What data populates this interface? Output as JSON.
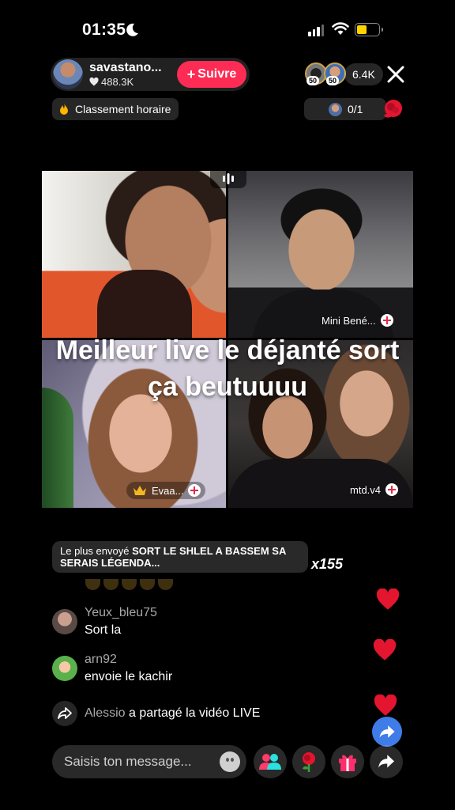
{
  "status_bar": {
    "time": "01:35",
    "battery_color": "#ffd400"
  },
  "host": {
    "name": "savastano...",
    "likes": "488.3K",
    "follow_label": "Suivre",
    "follow_color": "#fe2c55"
  },
  "top_right": {
    "viewer_badge_1": "50",
    "viewer_badge_2": "50",
    "viewer_count": "6.4K",
    "match_score": "0/1"
  },
  "ranking": {
    "label": "Classement horaire"
  },
  "guests": [
    {
      "name": ""
    },
    {
      "name": "Mini Bené..."
    },
    {
      "name": "Evaa..."
    },
    {
      "name": "mtd.v4"
    }
  ],
  "caption": "Meilleur live le déjanté sort ça beutuuuu",
  "top_gift": {
    "prefix": "Le plus envoyé",
    "message": "SORT LE SHLEL A BASSEM SA SERAIS LÉGENDA...",
    "count": "x155"
  },
  "comments": [
    {
      "user": "Yeux_bleu75",
      "text": "Sort la"
    },
    {
      "user": "arn92",
      "text": "envoie le kachir"
    }
  ],
  "share_event": {
    "user": "Alessio",
    "text": "a partagé la vidéo LIVE"
  },
  "input": {
    "placeholder": "Saisis ton message..."
  },
  "icons": [
    "moon-icon",
    "signal-icon",
    "wifi-icon",
    "battery-icon",
    "heart-icon",
    "close-icon",
    "fire-icon",
    "rose-icon",
    "crown-icon",
    "audio-icon",
    "share-icon",
    "emoji-icon",
    "guests-icon",
    "gift-icon"
  ]
}
